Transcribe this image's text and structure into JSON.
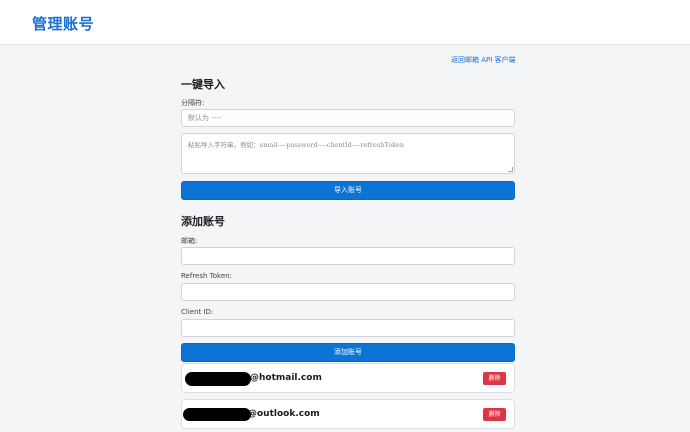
{
  "header": {
    "title": "管理账号"
  },
  "nav": {
    "back_link": "返回邮箱 API 客户端"
  },
  "import_section": {
    "title": "一键导入",
    "separator_label": "分隔符:",
    "separator_placeholder": "默认为 ----",
    "text_placeholder": "粘贴导入字符串，例如：email----password----clientId----refreshToken",
    "import_button": "导入账号"
  },
  "add_section": {
    "title": "添加账号",
    "email_label": "邮箱:",
    "email_value": "",
    "refresh_token_label": "Refresh Token:",
    "refresh_token_value": "",
    "client_id_label": "Client ID:",
    "client_id_value": "",
    "add_button": "添加账号"
  },
  "accounts": [
    {
      "email_suffix": "@hotmail.com",
      "delete_label": "删除"
    },
    {
      "email_suffix": "@outlook.com",
      "delete_label": "删除"
    }
  ],
  "colors": {
    "accent": "#0b74d5",
    "title_blue": "#1b6fd1",
    "danger": "#dc3545",
    "page_bg": "#f4f5f7"
  }
}
